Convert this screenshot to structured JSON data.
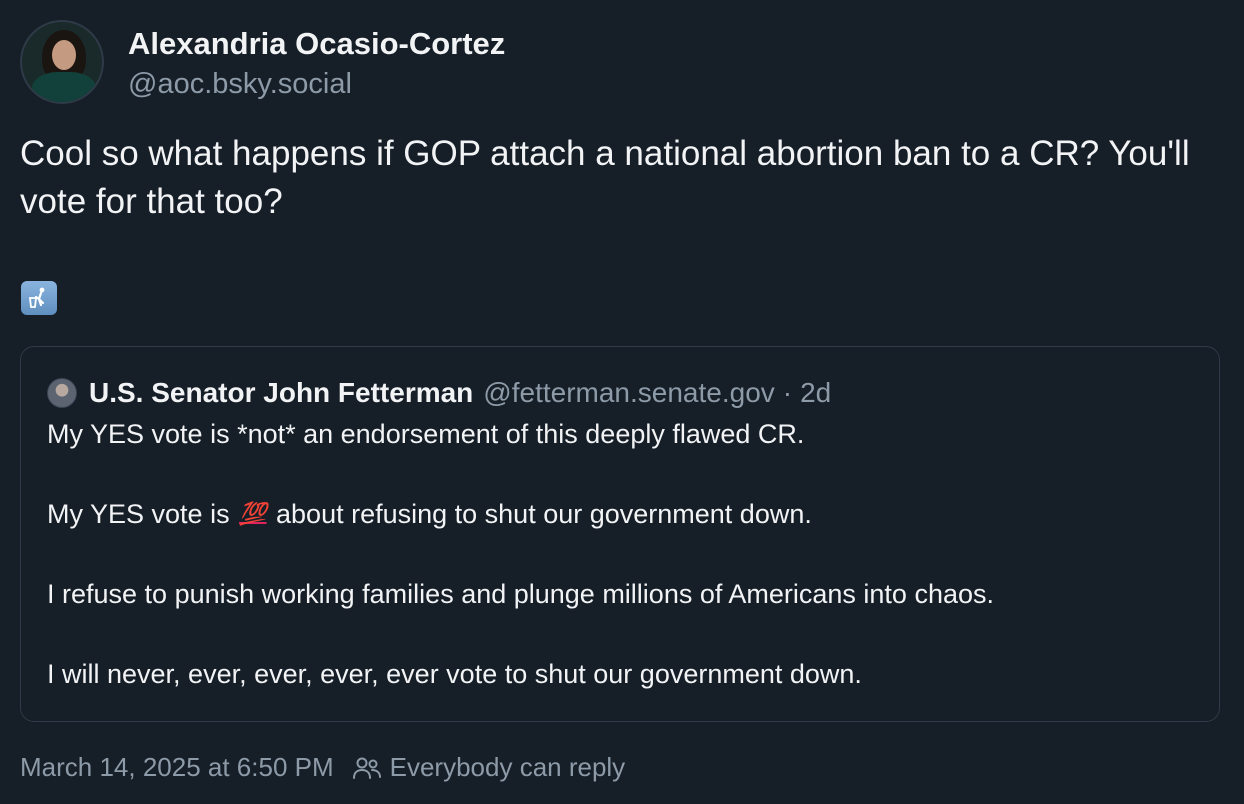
{
  "author": {
    "display_name": "Alexandria Ocasio-Cortez",
    "handle": "@aoc.bsky.social"
  },
  "post": {
    "text": "Cool so what happens if GOP attach a national abortion ban to a CR? You'll vote for that too?",
    "emoji_icon": "put-litter-in-its-place-icon"
  },
  "quoted_post": {
    "display_name": "U.S. Senator John Fetterman",
    "handle": "@fetterman.senate.gov",
    "separator": "·",
    "time": "2d",
    "lines": [
      "My YES vote is *not* an endorsement of this deeply flawed CR.",
      "My YES vote is",
      "💯",
      "about refusing to shut our government down.",
      "I refuse to punish working families and plunge millions of Americans into chaos.",
      "I will never, ever, ever, ever, ever vote to shut our government down."
    ]
  },
  "footer": {
    "timestamp": "March 14, 2025 at 6:50 PM",
    "reply_setting": "Everybody can reply"
  },
  "colors": {
    "background": "#161e27",
    "text": "#f1f3f5",
    "muted": "#8d9aa8",
    "border": "#2f3b49",
    "emoji_tile": "#6f9fd0"
  }
}
